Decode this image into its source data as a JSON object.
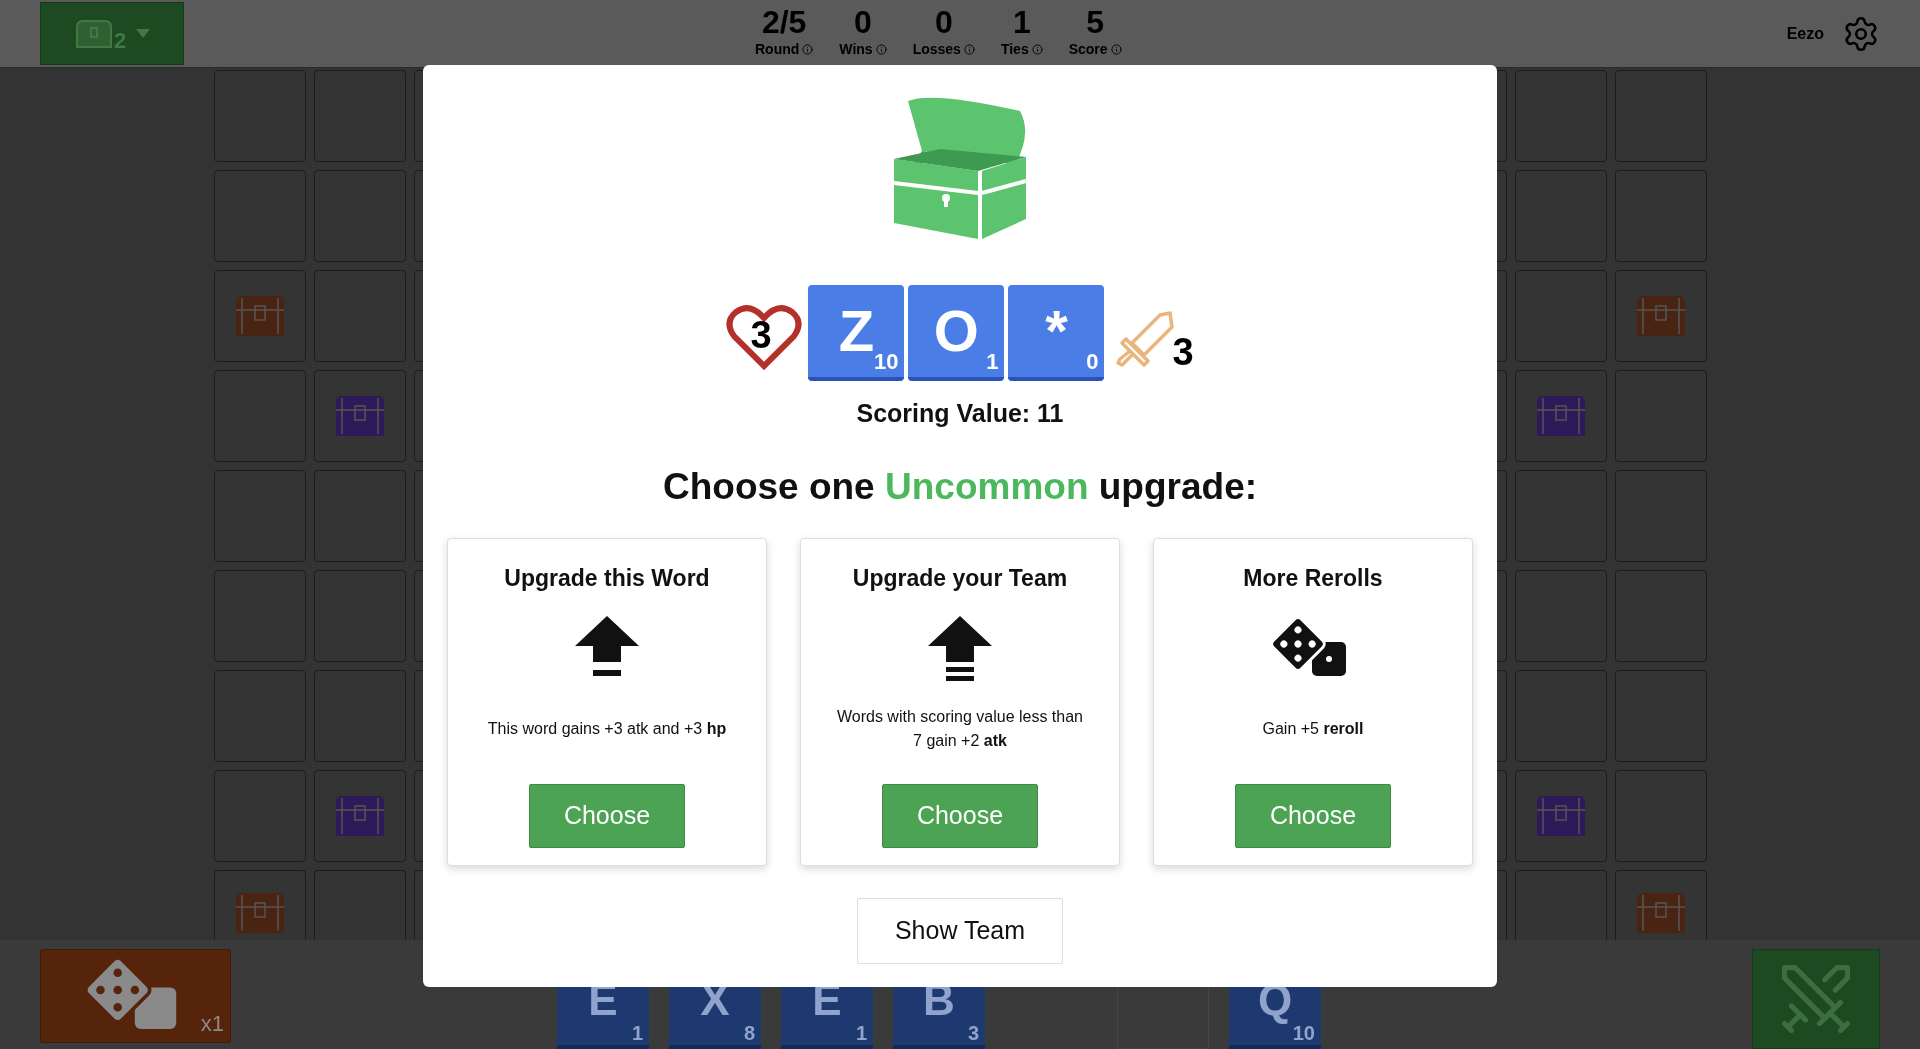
{
  "top_bar": {
    "team_button": {
      "count": "2"
    },
    "stats": [
      {
        "value": "2/5",
        "label": "Round"
      },
      {
        "value": "0",
        "label": "Wins"
      },
      {
        "value": "0",
        "label": "Losses"
      },
      {
        "value": "1",
        "label": "Ties"
      },
      {
        "value": "5",
        "label": "Score"
      }
    ],
    "username": "Eezo"
  },
  "board": {
    "rows": [
      {
        "cells": [
          {
            "kind": "empty"
          },
          {
            "kind": "empty"
          },
          {
            "kind": "empty"
          },
          {
            "kind": "empty"
          },
          {
            "kind": "empty"
          },
          {
            "kind": "empty"
          }
        ]
      },
      {
        "cells": [
          {
            "kind": "empty"
          },
          {
            "kind": "empty"
          },
          {
            "kind": "empty"
          },
          {
            "kind": "empty"
          },
          {
            "kind": "empty"
          },
          {
            "kind": "empty"
          }
        ]
      },
      {
        "cells": [
          {
            "kind": "chest",
            "color": "#4a2412"
          },
          {
            "kind": "empty"
          },
          {
            "kind": "empty"
          },
          {
            "kind": "empty"
          },
          {
            "kind": "empty"
          },
          {
            "kind": "chest",
            "color": "#4a2412"
          }
        ]
      },
      {
        "cells": [
          {
            "kind": "empty"
          },
          {
            "kind": "chest",
            "color": "#2c1b58"
          },
          {
            "kind": "empty"
          },
          {
            "kind": "empty"
          },
          {
            "kind": "chest",
            "color": "#2c1b58"
          },
          {
            "kind": "empty"
          }
        ]
      },
      {
        "cells": [
          {
            "kind": "empty"
          },
          {
            "kind": "empty"
          },
          {
            "kind": "empty"
          },
          {
            "kind": "empty"
          },
          {
            "kind": "empty"
          },
          {
            "kind": "empty"
          }
        ]
      },
      {
        "cells": [
          {
            "kind": "empty"
          },
          {
            "kind": "empty"
          },
          {
            "kind": "empty"
          },
          {
            "kind": "empty"
          },
          {
            "kind": "empty"
          },
          {
            "kind": "empty"
          }
        ]
      },
      {
        "cells": [
          {
            "kind": "empty"
          },
          {
            "kind": "empty"
          },
          {
            "kind": "empty"
          },
          {
            "kind": "empty"
          },
          {
            "kind": "empty"
          },
          {
            "kind": "empty"
          }
        ]
      },
      {
        "cells": [
          {
            "kind": "empty"
          },
          {
            "kind": "chest",
            "color": "#2c1b58"
          },
          {
            "kind": "empty"
          },
          {
            "kind": "empty"
          },
          {
            "kind": "chest",
            "color": "#2c1b58"
          },
          {
            "kind": "empty"
          }
        ]
      },
      {
        "cells": [
          {
            "kind": "chest",
            "color": "#4a2412"
          },
          {
            "kind": "empty"
          },
          {
            "kind": "empty"
          },
          {
            "kind": "empty"
          },
          {
            "kind": "empty"
          },
          {
            "kind": "chest",
            "color": "#4a2412"
          }
        ]
      }
    ]
  },
  "modal": {
    "word": {
      "hp": "3",
      "atk": "3",
      "tiles": [
        {
          "letter": "Z",
          "points": "10"
        },
        {
          "letter": "O",
          "points": "1"
        },
        {
          "letter": "*",
          "points": "0"
        }
      ]
    },
    "scoring_value": "Scoring Value: 11",
    "heading": {
      "before": "Choose one",
      "rarity": "Uncommon",
      "after": "upgrade:"
    },
    "cards": [
      {
        "title": "Upgrade this Word",
        "kind": "arrow_one_bar",
        "description": "This word gains +3 atk and +3 **hp**",
        "button": "Choose"
      },
      {
        "title": "Upgrade your Team",
        "kind": "arrow_two_bars",
        "description": "Words with scoring value less than 7 gain +2 **atk**",
        "button": "Choose"
      },
      {
        "title": "More Rerolls",
        "kind": "dice",
        "description": "Gain +5 **reroll**",
        "button": "Choose"
      }
    ],
    "show_team_button": "Show Team"
  },
  "bottom_bar": {
    "reroll_button": {
      "count": "x1"
    },
    "hand": [
      {
        "kind": "tile",
        "letter": "E",
        "points": "1"
      },
      {
        "kind": "tile",
        "letter": "X",
        "points": "8"
      },
      {
        "kind": "tile",
        "letter": "E",
        "points": "1"
      },
      {
        "kind": "tile",
        "letter": "B",
        "points": "3"
      },
      {
        "kind": "empty"
      },
      {
        "kind": "slot"
      },
      {
        "kind": "tile",
        "letter": "Q",
        "points": "10"
      }
    ]
  }
}
